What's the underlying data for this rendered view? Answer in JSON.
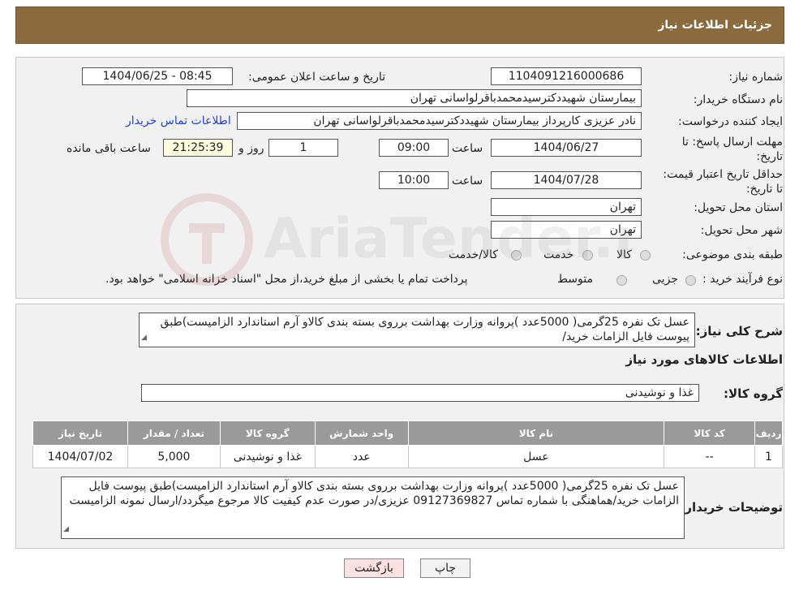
{
  "header": {
    "title": "جزئیات اطلاعات نیاز"
  },
  "form": {
    "need_number_label": "شماره نیاز:",
    "need_number": "1104091216000686",
    "announce_label": "تاریخ و ساعت اعلان عمومی:",
    "announce_value": "1404/06/25 - 08:45",
    "buyer_org_label": "نام دستگاه خریدار:",
    "buyer_org": "بیمارستان شهیددکترسیدمحمدباقرلواسانی تهران",
    "creator_label": "ایجاد کننده درخواست:",
    "creator": "نادر  عزیزی کارپرداز بیمارستان شهیددکترسیدمحمدباقرلواسانی تهران",
    "contact_link": "اطلاعات تماس خریدار",
    "deadline_label": "مهلت ارسال پاسخ: تا تاریخ:",
    "deadline_date": "1404/06/27",
    "time_label": "ساعت",
    "deadline_time": "09:00",
    "days_value": "1",
    "days_label": "روز و",
    "remaining_time": "21:25:39",
    "remaining_label": "ساعت باقی مانده",
    "validity_label": "حداقل تاریخ اعتبار قیمت: تا تاریخ:",
    "validity_date": "1404/07/28",
    "validity_time": "10:00",
    "province_label": "استان محل تحویل:",
    "province": "تهران",
    "city_label": "شهر محل تحویل:",
    "city": "تهران",
    "category_label": "طبقه بندی موضوعی:",
    "category_options": [
      "کالا",
      "خدمت",
      "کالا/خدمت"
    ],
    "purchase_type_label": "نوع فرآیند خرید :",
    "purchase_options": [
      "جزیی",
      "متوسط"
    ],
    "purchase_note": "پرداخت تمام یا بخشی از مبلغ خرید،از محل \"اسناد خزانه اسلامی\" خواهد بود."
  },
  "details": {
    "description_label": "شرح کلی نیاز:",
    "description": "عسل تک نفره 25گرمی( 5000عدد )پروانه وزارت بهداشت برروی بسته بندی کالاو آرم استاندارد الزامیست)طبق پیوست فایل الزامات خرید/",
    "goods_info_title": "اطلاعات کالاهای مورد نیاز",
    "goods_group_label": "گروه کالا:",
    "goods_group": "غذا و نوشیدنی",
    "table": {
      "headers": [
        "ردیف",
        "کد کالا",
        "نام کالا",
        "واحد شمارش",
        "گروه کالا",
        "تعداد / مقدار",
        "تاریخ نیاز"
      ],
      "rows": [
        [
          "1",
          "--",
          "عسل",
          "عدد",
          "غذا و نوشیدنی",
          "5,000",
          "1404/07/02"
        ]
      ]
    },
    "buyer_notes_label": "توضیحات خریدار:",
    "buyer_notes": "عسل تک نفره 25گرمی( 5000عدد )پروانه وزارت بهداشت برروی بسته بندی کالاو آرم استاندارد الزامیست)طبق پیوست فایل الزامات خرید/هماهنگی با شماره تماس 09127369827 عزیزی/در صورت عدم کیفیت کالا مرجوع میگردد/ارسال نمونه الزامیست"
  },
  "buttons": {
    "print": "چاپ",
    "back": "بازگشت"
  },
  "watermark": {
    "text": "AriaTender.neT"
  }
}
